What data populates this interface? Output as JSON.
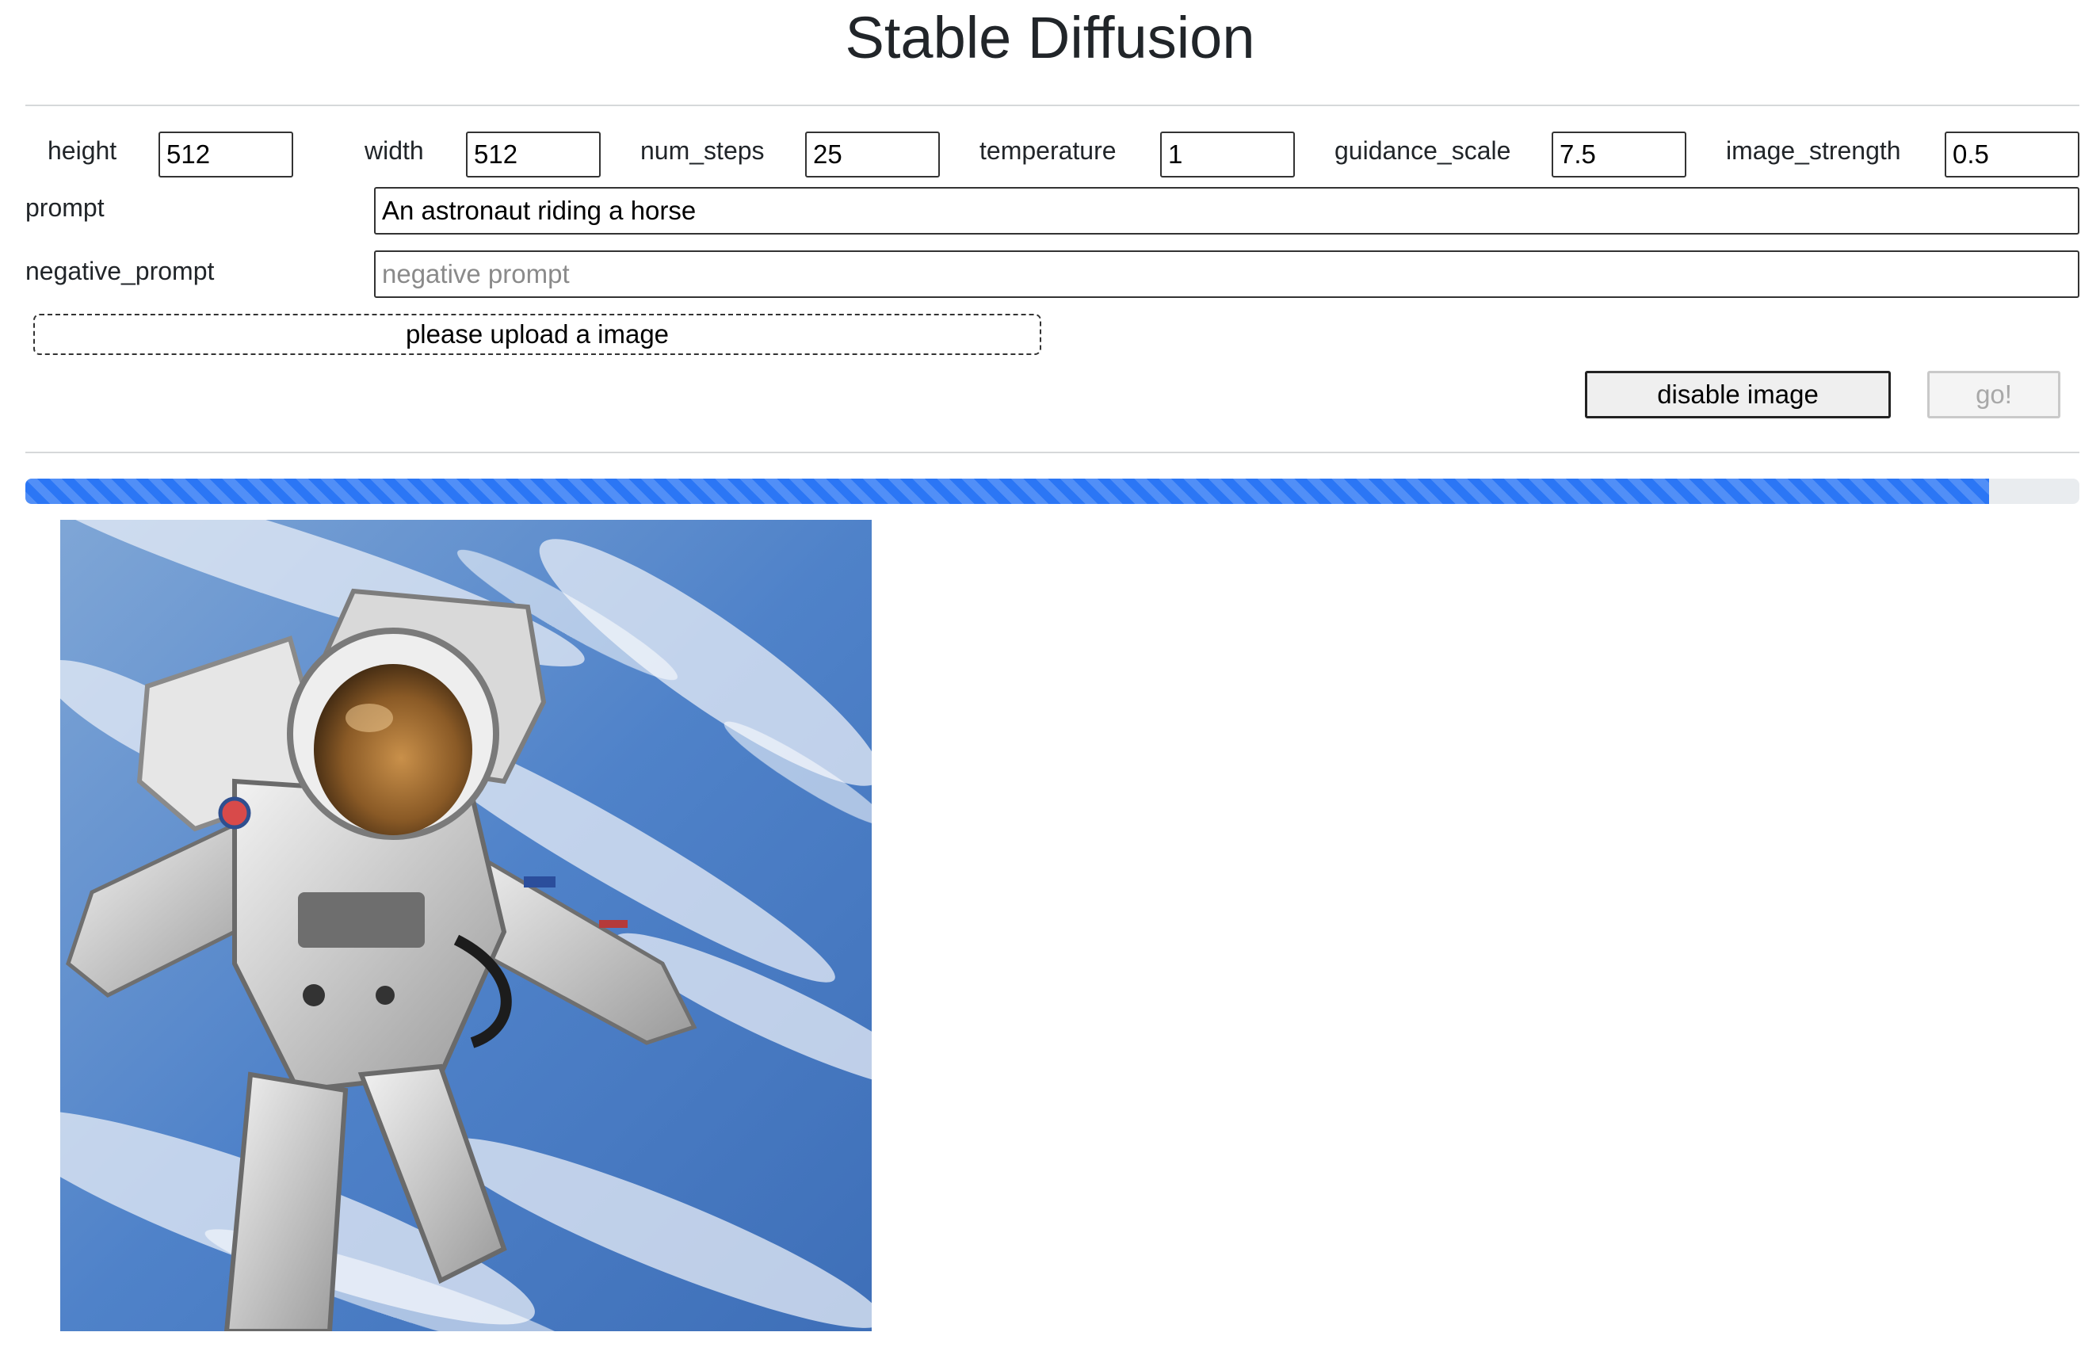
{
  "header": {
    "title": "Stable Diffusion"
  },
  "params": [
    {
      "label": "height",
      "value": "512"
    },
    {
      "label": "width",
      "value": "512"
    },
    {
      "label": "num_steps",
      "value": "25"
    },
    {
      "label": "temperature",
      "value": "1"
    },
    {
      "label": "guidance_scale",
      "value": "7.5"
    },
    {
      "label": "image_strength",
      "value": "0.5"
    }
  ],
  "prompt": {
    "label": "prompt",
    "value": "An astronaut riding a horse"
  },
  "negative_prompt": {
    "label": "negative_prompt",
    "value": "",
    "placeholder": "negative prompt"
  },
  "upload": {
    "label": "please upload a image"
  },
  "buttons": {
    "disable_image": "disable image",
    "go": "go!"
  },
  "progress": {
    "fraction": 0.956
  },
  "colors": {
    "progress_fill": "#2b76f5",
    "progress_track": "#e9ecef"
  },
  "result_image": {
    "subject": "astronaut-in-space"
  }
}
